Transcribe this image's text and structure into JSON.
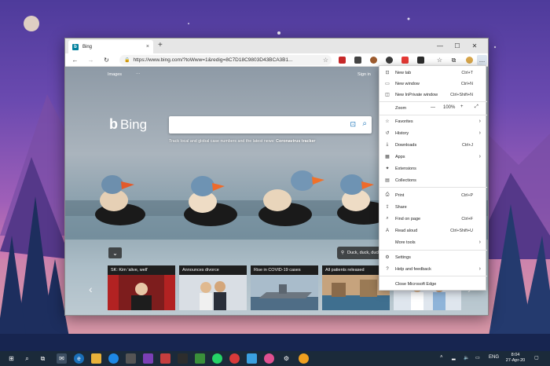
{
  "browser": {
    "tab_title": "Bing",
    "tab_close": "×",
    "new_tab": "+",
    "url": "https://www.bing.com/?toWww=1&redig=8C7D18C9803D43BCA3B1...",
    "window_controls": [
      "—",
      "☐",
      "✕"
    ]
  },
  "page": {
    "images_link": "Images",
    "more_link": "···",
    "sign_in": "Sign in",
    "logo_text": "Bing",
    "tagline_pre": "Track local and global case numbers and the latest news:",
    "tagline_link": "Coronavirus tracker",
    "location": "Duck, duck, duck",
    "collapse": "⌄",
    "news": [
      {
        "title": "SK: Kim 'alive, well'"
      },
      {
        "title": "Announces divorce"
      },
      {
        "title": "Rise in COVID-19 cases"
      },
      {
        "title": "All patients released"
      }
    ]
  },
  "menu": {
    "items": [
      {
        "label": "New tab",
        "shortcut": "Ctrl+T",
        "icon": "new-tab-icon",
        "glyph": "⊡"
      },
      {
        "label": "New window",
        "shortcut": "Ctrl+N",
        "icon": "new-window-icon",
        "glyph": "▭"
      },
      {
        "label": "New InPrivate window",
        "shortcut": "Ctrl+Shift+N",
        "icon": "inprivate-icon",
        "glyph": "◫"
      },
      {
        "label": "Zoom",
        "icon": "zoom-icon"
      },
      {
        "label": "Favorites",
        "icon": "favorites-icon",
        "glyph": "☆"
      },
      {
        "label": "History",
        "icon": "history-icon",
        "glyph": "↺"
      },
      {
        "label": "Downloads",
        "shortcut": "Ctrl+J",
        "icon": "downloads-icon",
        "glyph": "⤓"
      },
      {
        "label": "Apps",
        "icon": "apps-icon",
        "glyph": "▦"
      },
      {
        "label": "Extensions",
        "icon": "extensions-icon",
        "glyph": "✦"
      },
      {
        "label": "Collections",
        "icon": "collections-icon",
        "glyph": "▤"
      },
      {
        "label": "Print",
        "shortcut": "Ctrl+P",
        "icon": "print-icon",
        "glyph": "⎙"
      },
      {
        "label": "Share",
        "icon": "share-icon",
        "glyph": "⇪"
      },
      {
        "label": "Find on page",
        "shortcut": "Ctrl+F",
        "icon": "find-icon",
        "glyph": "⌕"
      },
      {
        "label": "Read aloud",
        "shortcut": "Ctrl+Shift+U",
        "icon": "read-aloud-icon",
        "glyph": "A"
      },
      {
        "label": "More tools",
        "icon": "more-tools-icon",
        "glyph": ""
      },
      {
        "label": "Settings",
        "icon": "settings-icon",
        "glyph": "⚙"
      },
      {
        "label": "Help and feedback",
        "icon": "help-icon",
        "glyph": "?"
      },
      {
        "label": "Close Microsoft Edge",
        "icon": "close-edge-icon",
        "glyph": ""
      }
    ],
    "zoom_minus": "—",
    "zoom_value": "100%",
    "zoom_plus": "+",
    "zoom_fullscreen": "⤢"
  },
  "taskbar": {
    "lang": "ENG",
    "time": "8:04",
    "date": "27-Apr-20"
  },
  "colors": {
    "accent": "#1a73b8",
    "taskbar": "#1b2a3a"
  }
}
